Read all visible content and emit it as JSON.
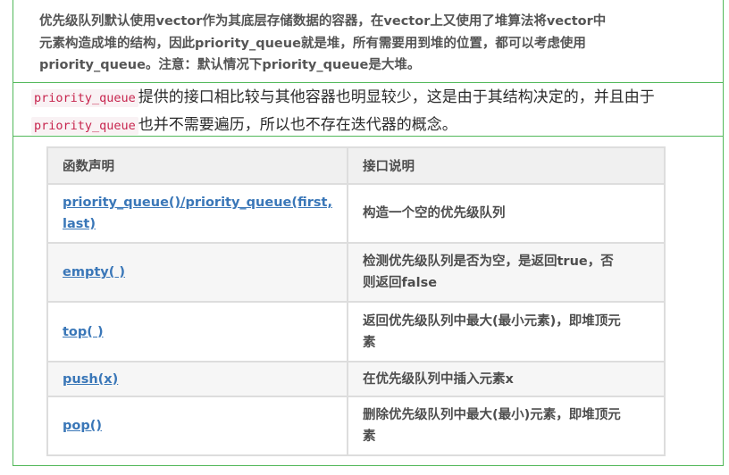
{
  "intro": {
    "line1": "优先级队列默认使用vector作为其底层存储数据的容器，在vector上又使用了堆算法将vector中",
    "line2": "元素构造成堆的结构，因此priority_queue就是堆，所有需要用到堆的位置，都可以考虑使用",
    "line3": "priority_queue。注意：默认情况下priority_queue是大堆。"
  },
  "paragraph": {
    "code1": "priority_queue",
    "text1": "提供的接口相比较与其他容器也明显较少，这是由于其结构决定的，并且由于",
    "code2": "priority_queue",
    "text2": "也并不需要遍历，所以也不存在迭代器的概念。"
  },
  "table": {
    "headers": [
      "函数声明",
      "接口说明"
    ],
    "rows": [
      {
        "fn_line1": "priority_queue()/priority_queue(first,",
        "fn_line2": "last)",
        "desc_line1": "构造一个空的优先级队列",
        "desc_line2": ""
      },
      {
        "fn_line1": "empty( )",
        "fn_line2": "",
        "desc_line1": "检测优先级队列是否为空，是返回true，否",
        "desc_line2": "则返回false"
      },
      {
        "fn_line1": "top( )",
        "fn_line2": "",
        "desc_line1": "返回优先级队列中最大(最小元素)，即堆顶元",
        "desc_line2": "素"
      },
      {
        "fn_line1": "push(x)",
        "fn_line2": "",
        "desc_line1": "在优先级队列中插入元素x",
        "desc_line2": ""
      },
      {
        "fn_line1": "pop()",
        "fn_line2": "",
        "desc_line1": "删除优先级队列中最大(最小)元素，即堆顶元",
        "desc_line2": "素"
      }
    ]
  },
  "colors": {
    "frame_border": "#52b85a",
    "link": "#3a77b8",
    "code_text": "#c7254e",
    "code_bg": "#f9f2f4"
  }
}
